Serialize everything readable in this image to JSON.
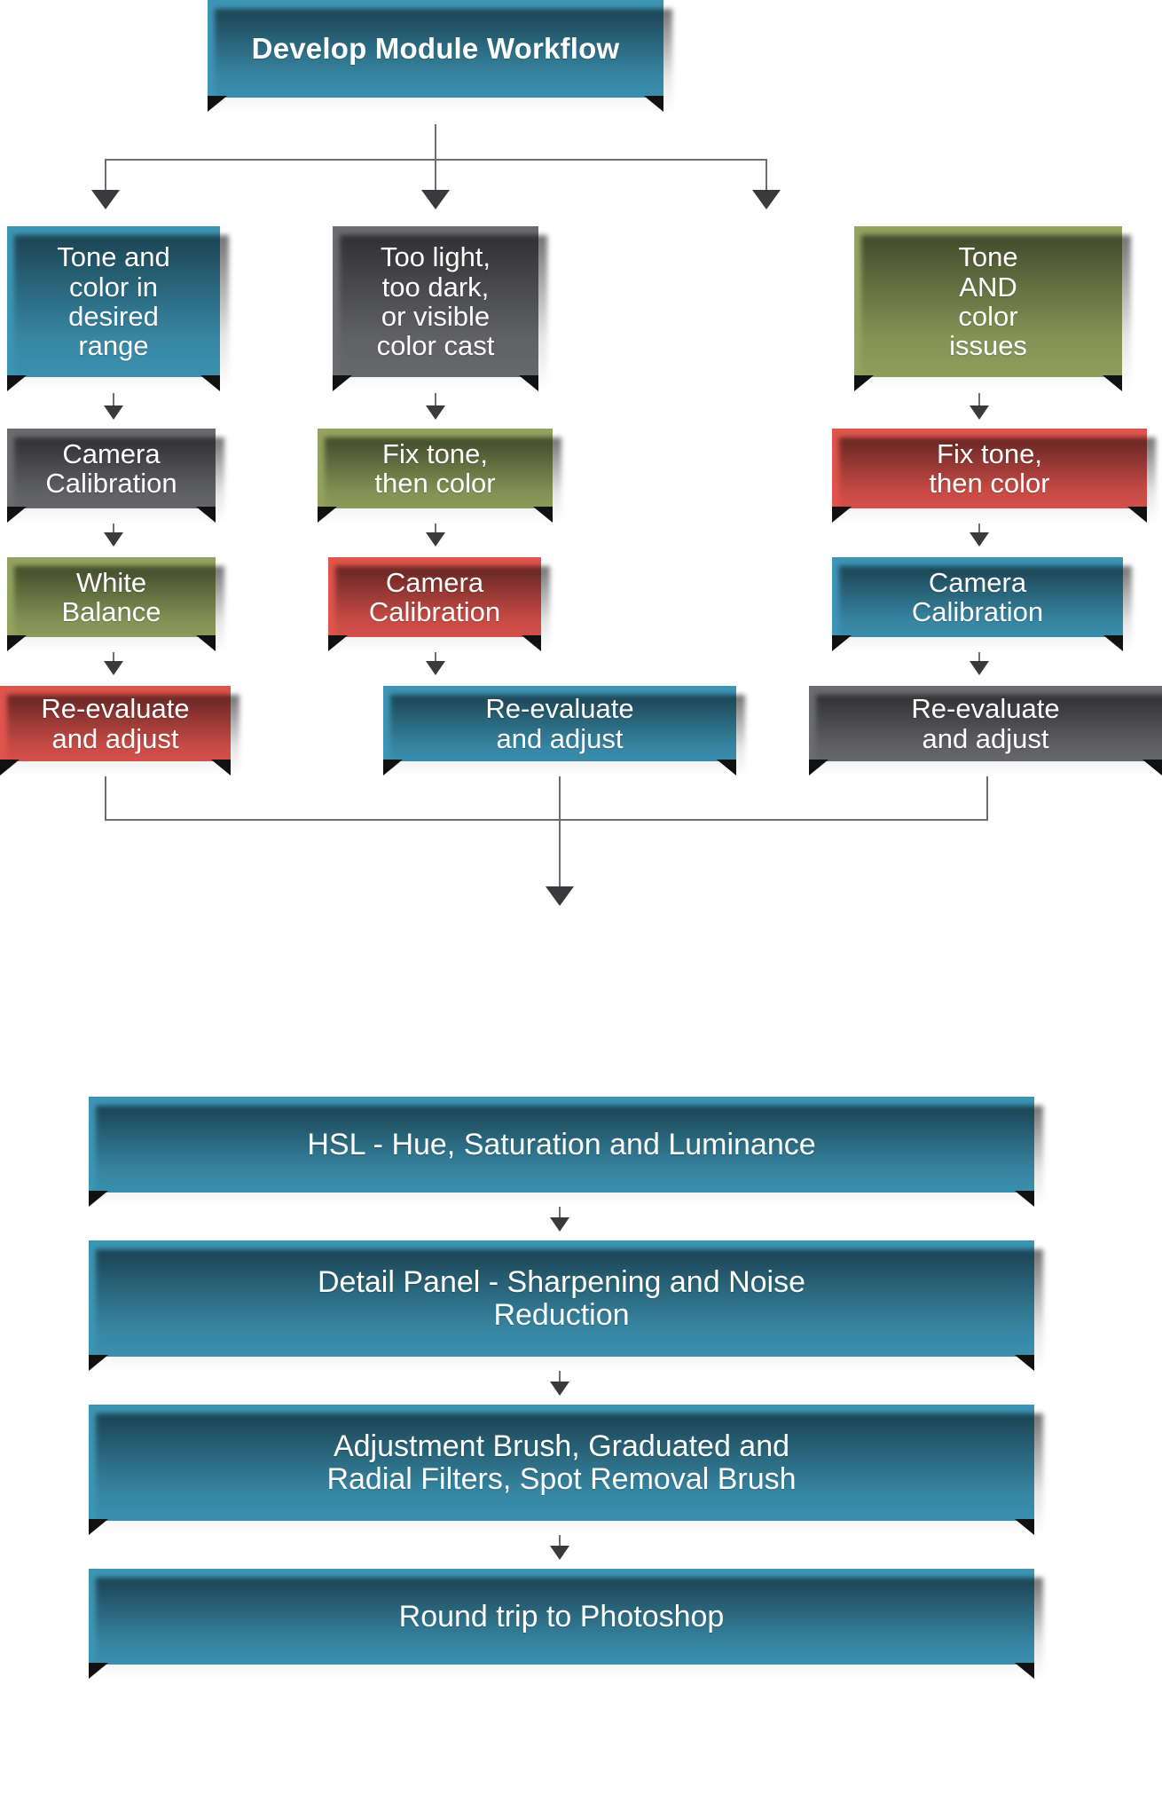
{
  "palette": {
    "blue": "#3d95b5",
    "gray": "#6b6c70",
    "green": "#93a35f",
    "red": "#e0544e",
    "connector": "#6d6e71",
    "arrow": "#3a3a3c",
    "text": "#ffffff",
    "background": "#ffffff"
  },
  "title": {
    "label": "Develop Module Workflow",
    "color": "blue"
  },
  "columns": [
    {
      "name": "left-branch",
      "steps": [
        {
          "label": "Tone and\ncolor in\ndesired\nrange",
          "color": "blue"
        },
        {
          "label": "Camera\nCalibration",
          "color": "gray"
        },
        {
          "label": "White\nBalance",
          "color": "green"
        },
        {
          "label": "Re-evaluate\nand adjust",
          "color": "red"
        }
      ]
    },
    {
      "name": "middle-branch",
      "steps": [
        {
          "label": "Too light,\ntoo dark,\nor visible\ncolor cast",
          "color": "gray"
        },
        {
          "label": "Fix tone,\nthen color",
          "color": "green"
        },
        {
          "label": "Camera\nCalibration",
          "color": "red"
        },
        {
          "label": "Re-evaluate\nand adjust",
          "color": "blue"
        }
      ]
    },
    {
      "name": "right-branch",
      "steps": [
        {
          "label": "Tone\nAND\ncolor\nissues",
          "color": "green"
        },
        {
          "label": "Fix tone,\nthen color",
          "color": "red"
        },
        {
          "label": "Camera\nCalibration",
          "color": "blue"
        },
        {
          "label": "Re-evaluate\nand adjust",
          "color": "gray"
        }
      ]
    }
  ],
  "final_steps": [
    {
      "label": "HSL - Hue, Saturation and Luminance",
      "color": "blue"
    },
    {
      "label": "Detail Panel - Sharpening and Noise\nReduction",
      "color": "blue"
    },
    {
      "label": "Adjustment Brush, Graduated and\nRadial Filters, Spot Removal Brush",
      "color": "blue"
    },
    {
      "label": "Round trip to Photoshop",
      "color": "blue"
    }
  ]
}
